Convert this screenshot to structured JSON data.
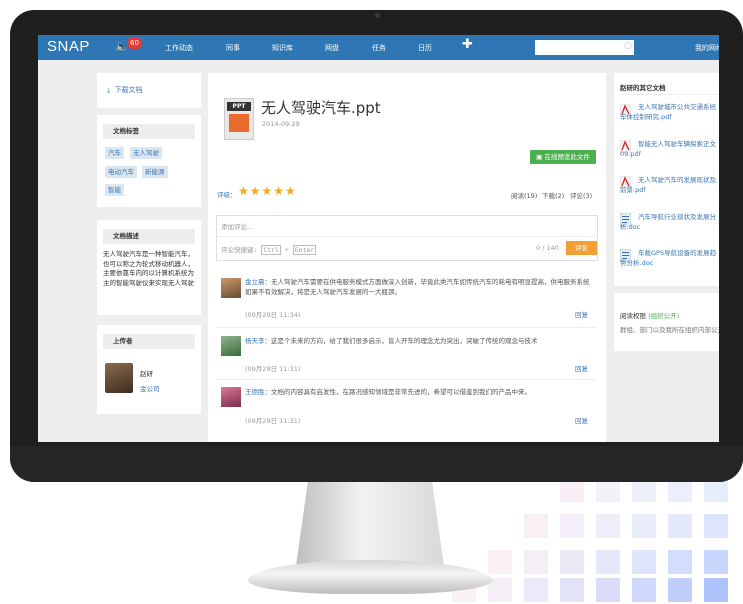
{
  "nav": {
    "logo": "SNAP",
    "notification_count": "60",
    "items": [
      "工作动态",
      "同事",
      "知识库",
      "网盘",
      "任务",
      "日历"
    ],
    "plus": "✚",
    "user_label": "我的网络"
  },
  "left": {
    "download_label": "下载文档",
    "tags_title": "文档标签",
    "tags": [
      "汽车",
      "无人驾驶",
      "电动汽车",
      "新能源",
      "智能"
    ],
    "desc_title": "文档描述",
    "description": "无人驾驶汽车是一种智能汽车，也可以称之为轮式移动机器人，主要依靠车内的以计算机系统为主的智能驾驶仪来实现无人驾驶",
    "uploader_title": "上传者",
    "uploader_name": "赵研",
    "uploader_company": "金公司"
  },
  "doc": {
    "file_type": "PPT",
    "title": "无人驾驶汽车.ppt",
    "date": "2014-09-29",
    "preview_label": "在线预览此文件",
    "rating_label": "评级：",
    "stars": "★★★★★",
    "reads": "阅读(19)",
    "downloads": "下载(2)",
    "comments_count": "评论(3)"
  },
  "comment_form": {
    "placeholder": "添加评论...",
    "shortcut_prefix": "评论快捷键:",
    "key_ctrl": "Ctrl",
    "key_plus": "+",
    "key_enter": "Enter",
    "char_count": "0 / 140",
    "submit_label": "评论"
  },
  "comments": [
    {
      "user": "金立晨",
      "text": "：无人驾驶汽车需要在供电服务模式方面做深入创新，毕竟此类汽车如传统汽车的耗电有明显提高，供电服务系统如果不有效解决，将是无人驾驶汽车发展的一大瓶颈。",
      "time": "(09月29日 11:34)",
      "reply": "回复"
    },
    {
      "user": "杨天李",
      "text": "：这是个未来的方向，给了我们很多启示，盲人开车的理念尤为突出，突破了传统的观念与技术",
      "time": "(09月29日 11:31)",
      "reply": "回复"
    },
    {
      "user": "王德胜",
      "text": "：文档的内容具有启发性，在路况感知领域是非常先进的，希望可以借鉴到我们的产品中来。",
      "time": "(09月29日 11:31)",
      "reply": "回复"
    }
  ],
  "right": {
    "other_docs_title": "赵研的其它文档",
    "docs": [
      {
        "name": "无人驾驶城市公共交通系统车体控制研究.pdf",
        "icon": "pdf-icon"
      },
      {
        "name": "智能无人驾驶车辆探索正文09.pdf",
        "icon": "pdf-icon"
      },
      {
        "name": "无人驾驶汽车的发展现状及前景.pdf",
        "icon": "pdf-icon"
      },
      {
        "name": "汽车导航行业现状及发展分析.doc",
        "icon": "doc-icon"
      },
      {
        "name": "车载GPS导航设备的发展趋势分析.doc",
        "icon": "doc-icon"
      }
    ],
    "permission_title": "阅读权限",
    "permission_scope": "(组织公开)",
    "permission_text": "群组、部门以及我所在组织内部公开"
  }
}
